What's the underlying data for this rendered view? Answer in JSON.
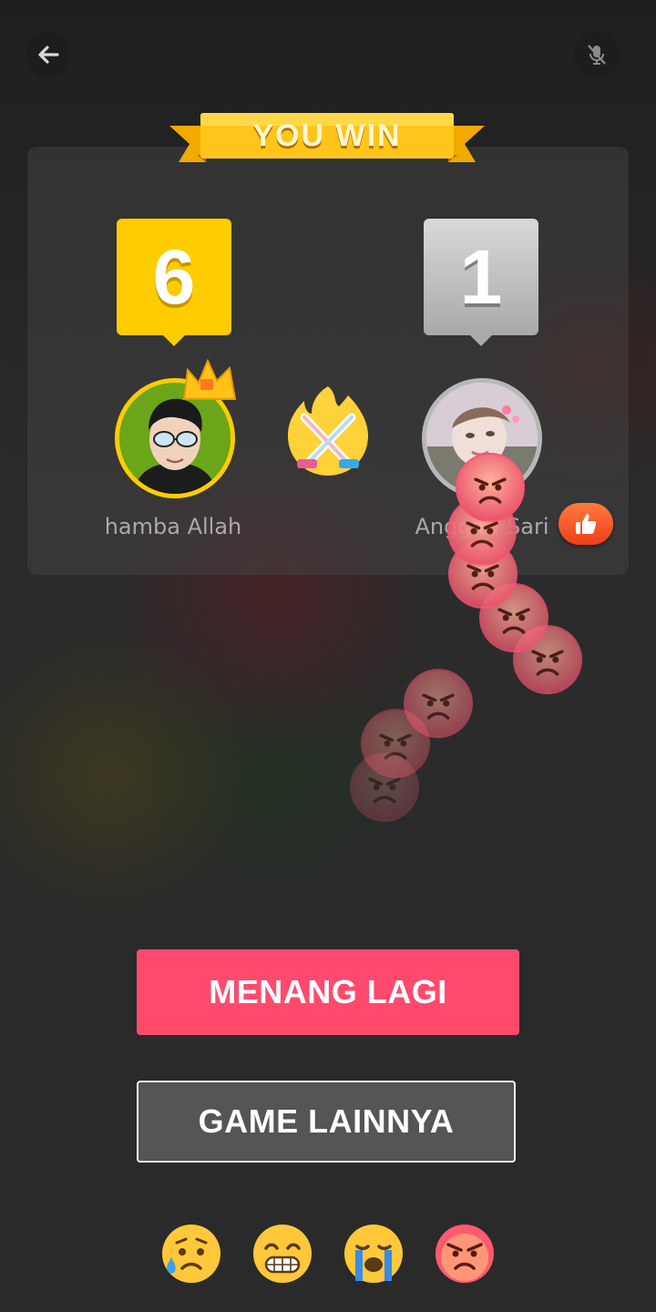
{
  "header": {
    "back_icon": "arrow-left-icon",
    "mic_icon": "mic-off-icon"
  },
  "result": {
    "banner_text": "YOU WIN",
    "colors": {
      "winner": "#ffcc00",
      "loser": "#a9a9a9",
      "accent": "#ff4a6e"
    }
  },
  "players": [
    {
      "name": "hamba Allah",
      "score": "6",
      "crown": true
    },
    {
      "name": "Anggita Sari",
      "score": "1",
      "crown": false
    }
  ],
  "actions": {
    "play_again": "MENANG LAGI",
    "other_games": "GAME LAINNYA"
  },
  "reactions": [
    "worried-sweat-icon",
    "grin-icon",
    "crying-icon",
    "angry-icon"
  ],
  "flying_reaction": "angry-icon"
}
